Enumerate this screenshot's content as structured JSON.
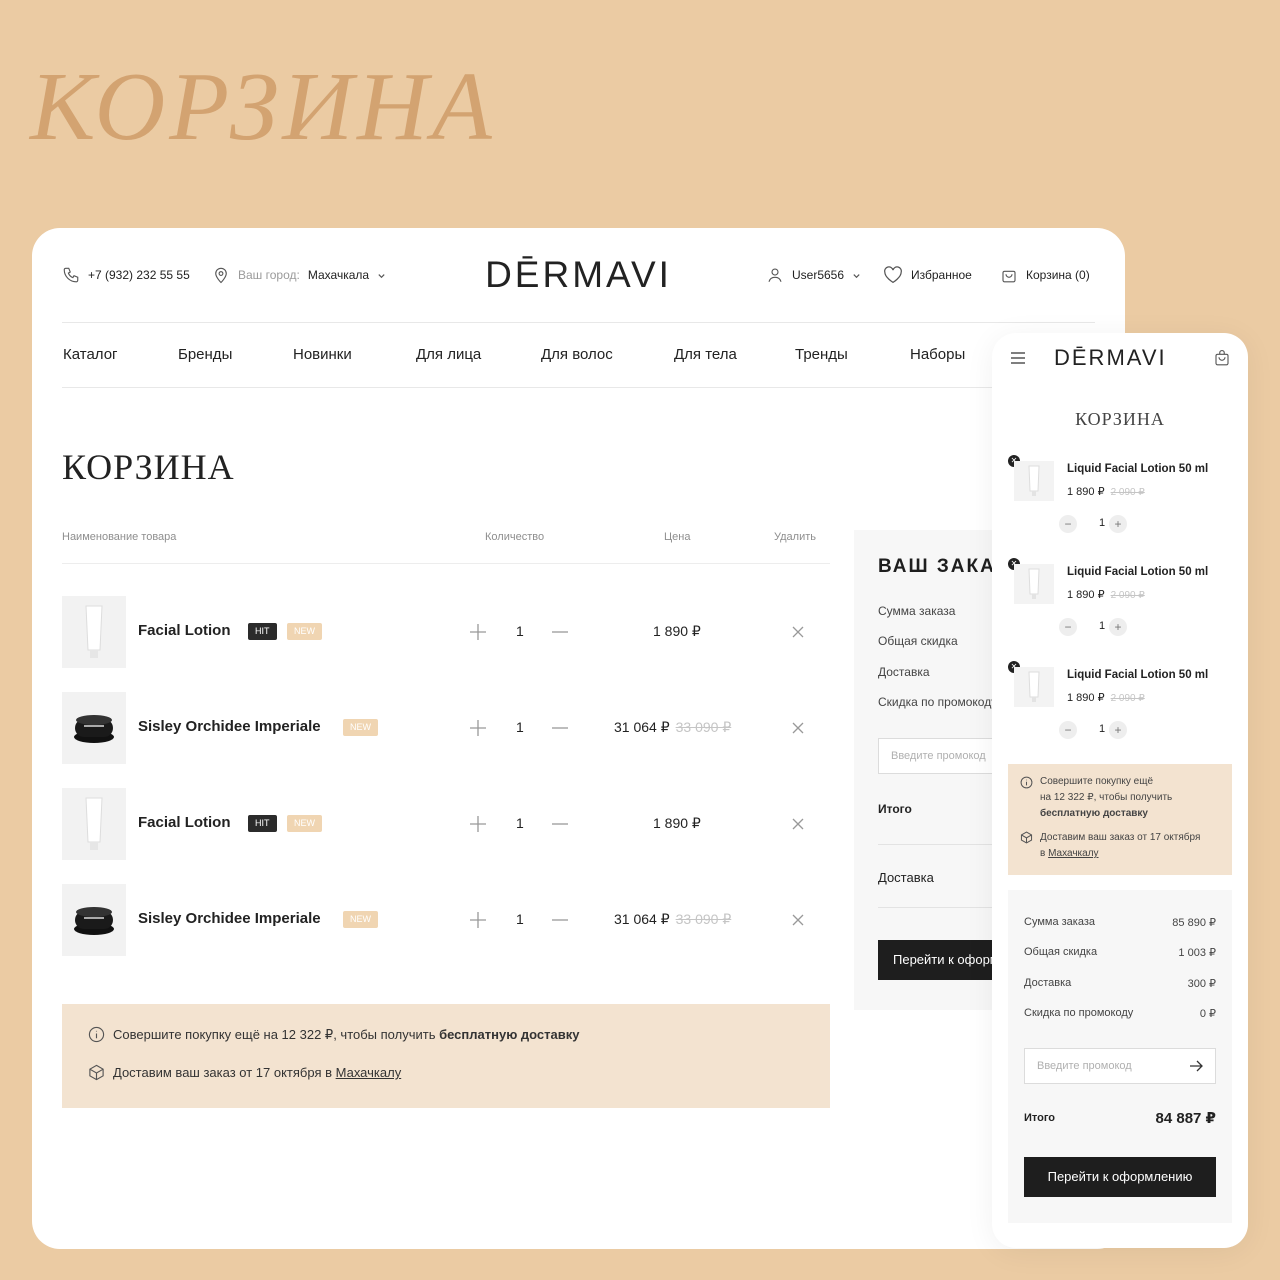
{
  "hero_title": "КОРЗИНА",
  "colors": {
    "background": "#ebcba3",
    "accent": "#d3a371",
    "promo_bg": "#f3e3d0",
    "dark": "#1e1e1e"
  },
  "header": {
    "phone": "+7 (932) 232 55 55",
    "city_label": "Ваш город:",
    "city": "Махачкала",
    "logo": "DĒRMAVI",
    "user": "User5656",
    "favorites": "Избранное",
    "cart": "Корзина (0)"
  },
  "nav": [
    "Каталог",
    "Бренды",
    "Новинки",
    "Для лица",
    "Для волос",
    "Для тела",
    "Тренды",
    "Наборы"
  ],
  "cart": {
    "title": "КОРЗИНА",
    "columns": {
      "name": "Наименование товара",
      "qty": "Количество",
      "price": "Цена",
      "delete": "Удалить"
    },
    "items": [
      {
        "name": "Facial Lotion",
        "hit": "HIT",
        "new": "NEW",
        "qty": "1",
        "price": "1 890 ₽",
        "old_price": ""
      },
      {
        "name": "Sisley Orchidee Imperiale",
        "hit": "",
        "new": "NEW",
        "qty": "1",
        "price": "31 064 ₽",
        "old_price": "33 090 ₽"
      },
      {
        "name": "Facial Lotion",
        "hit": "HIT",
        "new": "NEW",
        "qty": "1",
        "price": "1 890 ₽",
        "old_price": ""
      },
      {
        "name": "Sisley Orchidee Imperiale",
        "hit": "",
        "new": "NEW",
        "qty": "1",
        "price": "31 064 ₽",
        "old_price": "33 090 ₽"
      }
    ],
    "promo": {
      "line1_pre": "Совершите покупку ещё на 12 322 ₽, чтобы получить ",
      "line1_bold": "бесплатную доставку",
      "line2_pre": "Доставим ваш заказ от 17 октября в ",
      "line2_link": "Махачкалу"
    }
  },
  "order": {
    "title": "ВАШ ЗАКАЗ",
    "sum_label": "Сумма заказа",
    "discount_label": "Общая скидка",
    "delivery_label": "Доставка",
    "promo_discount_label": "Скидка по промокоду",
    "promo_placeholder": "Введите промокод",
    "total_label": "Итого",
    "delivery_row": "Доставка",
    "checkout_button": "Перейти к оформлению"
  },
  "mobile": {
    "logo": "DĒRMAVI",
    "title": "КОРЗИНА",
    "items": [
      {
        "name": "Liquid Facial Lotion 50 ml",
        "price": "1 890 ₽",
        "old_price": "2 090 ₽",
        "qty": "1"
      },
      {
        "name": "Liquid Facial Lotion 50 ml",
        "price": "1 890 ₽",
        "old_price": "2 090 ₽",
        "qty": "1"
      },
      {
        "name": "Liquid Facial Lotion 50 ml",
        "price": "1 890 ₽",
        "old_price": "2 090 ₽",
        "qty": "1"
      }
    ],
    "promo": {
      "l1": "Совершите покупку ещё",
      "l2": "на 12 322 ₽, чтобы получить",
      "l3": "бесплатную доставку",
      "l4": "Доставим ваш заказ от 17 октября",
      "l5_pre": "в ",
      "l5_link": "Махачкалу"
    },
    "summary": {
      "sum_label": "Сумма заказа",
      "sum_value": "85 890 ₽",
      "discount_label": "Общая скидка",
      "discount_value": "1 003 ₽",
      "delivery_label": "Доставка",
      "delivery_value": "300 ₽",
      "promo_label": "Скидка по промокоду",
      "promo_value": "0 ₽",
      "promo_placeholder": "Введите промокод",
      "total_label": "Итого",
      "total_value": "84 887 ₽",
      "checkout_button": "Перейти к оформлению"
    }
  }
}
